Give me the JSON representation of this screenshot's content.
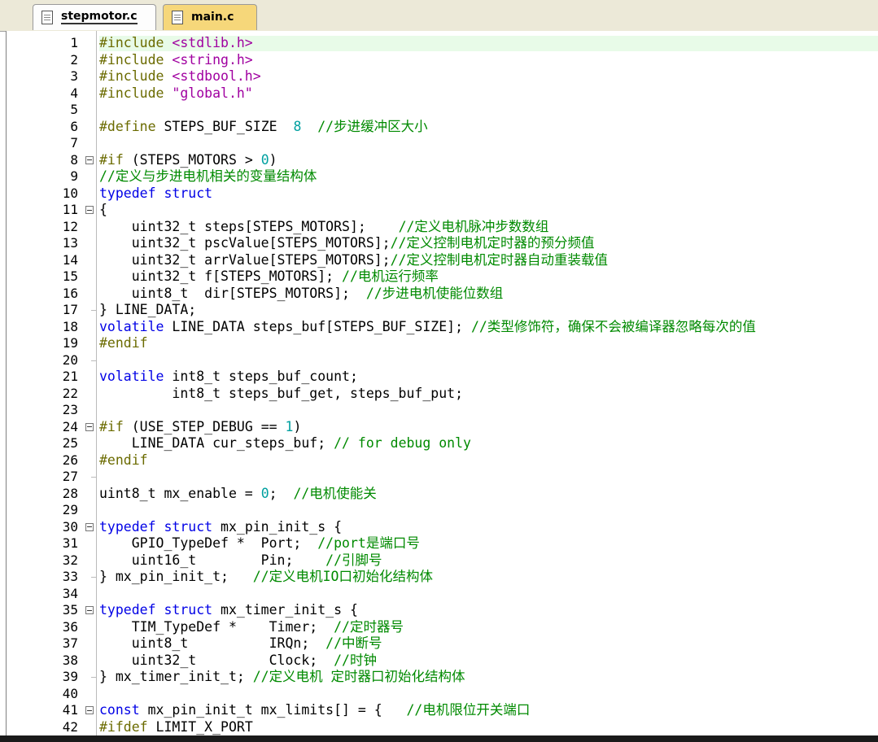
{
  "tabs": [
    {
      "label": "stepmotor.c",
      "active": true
    },
    {
      "label": "main.c",
      "active": false
    }
  ],
  "colors": {
    "keyword": "#0000e6",
    "preprocessor": "#6b6b00",
    "string": "#a000a0",
    "comment": "#008a00",
    "number": "#00a0a0",
    "active_tab": "#fdfdfd",
    "inactive_tab": "#f6d77a",
    "current_line": "#e8fbe8"
  },
  "icons": [
    "file-icon",
    "fold-collapse-icon"
  ],
  "current_line": 1,
  "lines": [
    {
      "n": 1,
      "fold": "",
      "tokens": [
        {
          "t": "pp",
          "v": "#include "
        },
        {
          "t": "str",
          "v": "<stdlib.h>"
        }
      ]
    },
    {
      "n": 2,
      "fold": "",
      "tokens": [
        {
          "t": "pp",
          "v": "#include "
        },
        {
          "t": "str",
          "v": "<string.h>"
        }
      ]
    },
    {
      "n": 3,
      "fold": "",
      "tokens": [
        {
          "t": "pp",
          "v": "#include "
        },
        {
          "t": "str",
          "v": "<stdbool.h>"
        }
      ]
    },
    {
      "n": 4,
      "fold": "",
      "tokens": [
        {
          "t": "pp",
          "v": "#include "
        },
        {
          "t": "str",
          "v": "\"global.h\""
        }
      ]
    },
    {
      "n": 5,
      "fold": "",
      "tokens": []
    },
    {
      "n": 6,
      "fold": "",
      "tokens": [
        {
          "t": "pp",
          "v": "#define "
        },
        {
          "t": "",
          "v": "STEPS_BUF_SIZE  "
        },
        {
          "t": "num",
          "v": "8"
        },
        {
          "t": "",
          "v": "  "
        },
        {
          "t": "cmt",
          "v": "//步进缓冲区大小"
        }
      ]
    },
    {
      "n": 7,
      "fold": "",
      "tokens": []
    },
    {
      "n": 8,
      "fold": "start",
      "tokens": [
        {
          "t": "pp",
          "v": "#if "
        },
        {
          "t": "",
          "v": "(STEPS_MOTORS > "
        },
        {
          "t": "num",
          "v": "0"
        },
        {
          "t": "",
          "v": ")"
        }
      ]
    },
    {
      "n": 9,
      "fold": "",
      "tokens": [
        {
          "t": "cmt",
          "v": "//定义与步进电机相关的变量结构体"
        }
      ]
    },
    {
      "n": 10,
      "fold": "",
      "tokens": [
        {
          "t": "kw",
          "v": "typedef struct"
        }
      ]
    },
    {
      "n": 11,
      "fold": "start",
      "tokens": [
        {
          "t": "",
          "v": "{"
        }
      ]
    },
    {
      "n": 12,
      "fold": "",
      "tokens": [
        {
          "t": "",
          "v": "    uint32_t steps[STEPS_MOTORS];    "
        },
        {
          "t": "cmt",
          "v": "//定义电机脉冲步数数组"
        }
      ]
    },
    {
      "n": 13,
      "fold": "",
      "tokens": [
        {
          "t": "",
          "v": "    uint32_t pscValue[STEPS_MOTORS];"
        },
        {
          "t": "cmt",
          "v": "//定义控制电机定时器的预分频值"
        }
      ]
    },
    {
      "n": 14,
      "fold": "",
      "tokens": [
        {
          "t": "",
          "v": "    uint32_t arrValue[STEPS_MOTORS];"
        },
        {
          "t": "cmt",
          "v": "//定义控制电机定时器自动重装载值"
        }
      ]
    },
    {
      "n": 15,
      "fold": "",
      "tokens": [
        {
          "t": "",
          "v": "    uint32_t f[STEPS_MOTORS]; "
        },
        {
          "t": "cmt",
          "v": "//电机运行频率"
        }
      ]
    },
    {
      "n": 16,
      "fold": "",
      "tokens": [
        {
          "t": "",
          "v": "    uint8_t  dir[STEPS_MOTORS];  "
        },
        {
          "t": "cmt",
          "v": "//步进电机使能位数组"
        }
      ]
    },
    {
      "n": 17,
      "fold": "end",
      "tokens": [
        {
          "t": "",
          "v": "} LINE_DATA;"
        }
      ]
    },
    {
      "n": 18,
      "fold": "",
      "tokens": [
        {
          "t": "kw",
          "v": "volatile"
        },
        {
          "t": "",
          "v": " LINE_DATA steps_buf[STEPS_BUF_SIZE]; "
        },
        {
          "t": "cmt",
          "v": "//类型修饰符，确保不会被编译器忽略每次的值"
        }
      ]
    },
    {
      "n": 19,
      "fold": "",
      "tokens": [
        {
          "t": "pp",
          "v": "#endif"
        }
      ]
    },
    {
      "n": 20,
      "fold": "end",
      "tokens": []
    },
    {
      "n": 21,
      "fold": "",
      "tokens": [
        {
          "t": "kw",
          "v": "volatile"
        },
        {
          "t": "",
          "v": " int8_t steps_buf_count;"
        }
      ]
    },
    {
      "n": 22,
      "fold": "",
      "tokens": [
        {
          "t": "",
          "v": "         int8_t steps_buf_get, steps_buf_put;"
        }
      ]
    },
    {
      "n": 23,
      "fold": "",
      "tokens": []
    },
    {
      "n": 24,
      "fold": "start",
      "tokens": [
        {
          "t": "pp",
          "v": "#if "
        },
        {
          "t": "",
          "v": "(USE_STEP_DEBUG == "
        },
        {
          "t": "num",
          "v": "1"
        },
        {
          "t": "",
          "v": ")"
        }
      ]
    },
    {
      "n": 25,
      "fold": "",
      "tokens": [
        {
          "t": "",
          "v": "    LINE_DATA cur_steps_buf; "
        },
        {
          "t": "cmt",
          "v": "// for debug only"
        }
      ]
    },
    {
      "n": 26,
      "fold": "",
      "tokens": [
        {
          "t": "pp",
          "v": "#endif"
        }
      ]
    },
    {
      "n": 27,
      "fold": "end",
      "tokens": []
    },
    {
      "n": 28,
      "fold": "",
      "tokens": [
        {
          "t": "",
          "v": "uint8_t mx_enable = "
        },
        {
          "t": "num",
          "v": "0"
        },
        {
          "t": "",
          "v": ";  "
        },
        {
          "t": "cmt",
          "v": "//电机使能关"
        }
      ]
    },
    {
      "n": 29,
      "fold": "",
      "tokens": []
    },
    {
      "n": 30,
      "fold": "start",
      "tokens": [
        {
          "t": "kw",
          "v": "typedef struct"
        },
        {
          "t": "",
          "v": " mx_pin_init_s {"
        }
      ]
    },
    {
      "n": 31,
      "fold": "",
      "tokens": [
        {
          "t": "",
          "v": "    GPIO_TypeDef *  Port;  "
        },
        {
          "t": "cmt",
          "v": "//port是端口号"
        }
      ]
    },
    {
      "n": 32,
      "fold": "",
      "tokens": [
        {
          "t": "",
          "v": "    uint16_t        Pin;    "
        },
        {
          "t": "cmt",
          "v": "//引脚号"
        }
      ]
    },
    {
      "n": 33,
      "fold": "end",
      "tokens": [
        {
          "t": "",
          "v": "} mx_pin_init_t;   "
        },
        {
          "t": "cmt",
          "v": "//定义电机IO口初始化结构体"
        }
      ]
    },
    {
      "n": 34,
      "fold": "",
      "tokens": []
    },
    {
      "n": 35,
      "fold": "start",
      "tokens": [
        {
          "t": "kw",
          "v": "typedef struct"
        },
        {
          "t": "",
          "v": " mx_timer_init_s {"
        }
      ]
    },
    {
      "n": 36,
      "fold": "",
      "tokens": [
        {
          "t": "",
          "v": "    TIM_TypeDef *    Timer;  "
        },
        {
          "t": "cmt",
          "v": "//定时器号"
        }
      ]
    },
    {
      "n": 37,
      "fold": "",
      "tokens": [
        {
          "t": "",
          "v": "    uint8_t          IRQn;  "
        },
        {
          "t": "cmt",
          "v": "//中断号"
        }
      ]
    },
    {
      "n": 38,
      "fold": "",
      "tokens": [
        {
          "t": "",
          "v": "    uint32_t         Clock;  "
        },
        {
          "t": "cmt",
          "v": "//时钟"
        }
      ]
    },
    {
      "n": 39,
      "fold": "end",
      "tokens": [
        {
          "t": "",
          "v": "} mx_timer_init_t; "
        },
        {
          "t": "cmt",
          "v": "//定义电机 定时器口初始化结构体"
        }
      ]
    },
    {
      "n": 40,
      "fold": "",
      "tokens": []
    },
    {
      "n": 41,
      "fold": "start",
      "tokens": [
        {
          "t": "kw",
          "v": "const"
        },
        {
          "t": "",
          "v": " mx_pin_init_t mx_limits[] = {   "
        },
        {
          "t": "cmt",
          "v": "//电机限位开关端口"
        }
      ]
    },
    {
      "n": 42,
      "fold": "",
      "tokens": [
        {
          "t": "pp",
          "v": "#ifdef "
        },
        {
          "t": "",
          "v": "LIMIT_X_PORT"
        }
      ]
    }
  ]
}
